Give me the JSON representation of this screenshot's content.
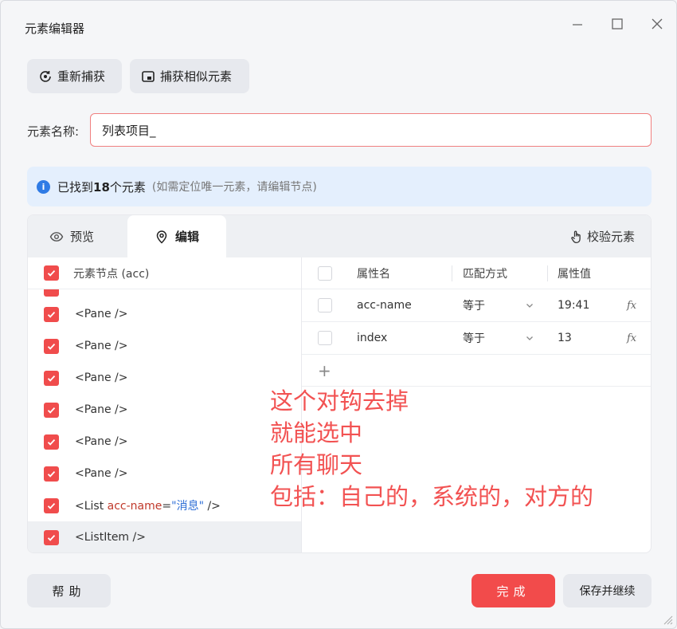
{
  "window": {
    "title": "元素编辑器"
  },
  "toolbar": {
    "recapture_label": "重新捕获",
    "capture_similar_label": "捕获相似元素"
  },
  "element_name": {
    "label": "元素名称:",
    "value": "列表项目_"
  },
  "info": {
    "found_prefix": "已找到",
    "count": "18",
    "found_suffix": "个元素",
    "hint": "(如需定位唯一元素，请编辑节点)"
  },
  "tabs": {
    "preview_label": "预览",
    "edit_label": "编辑",
    "verify_label": "校验元素",
    "active": "edit"
  },
  "tree": {
    "header_label": "元素节点 (acc)",
    "rows": [
      {
        "text": "<Pane />",
        "checked": true
      },
      {
        "text": "<Pane />",
        "checked": true
      },
      {
        "text": "<Pane />",
        "checked": true
      },
      {
        "text": "<Pane />",
        "checked": true
      },
      {
        "text": "<Pane />",
        "checked": true
      },
      {
        "text": "<Pane />",
        "checked": true
      }
    ],
    "list_row": {
      "open": "<List ",
      "attr_name": "acc-name",
      "eq": "=",
      "attr_value": "\"消息\"",
      "close": " />",
      "checked": true
    },
    "selected_row": {
      "text": "<ListItem />",
      "checked": true
    }
  },
  "attributes": {
    "headers": {
      "name": "属性名",
      "match": "匹配方式",
      "value": "属性值"
    },
    "rows": [
      {
        "name": "acc-name",
        "match": "等于",
        "value": "19:41",
        "fx": "fx",
        "checked": false
      },
      {
        "name": "index",
        "match": "等于",
        "value": "13",
        "fx": "fx",
        "checked": false
      }
    ],
    "add_label": "+"
  },
  "annotation": {
    "lines": [
      "这个对钩去掉",
      "就能选中",
      "所有聊天",
      "包括：自己的，系统的，对方的"
    ],
    "color": "#f25252"
  },
  "footer": {
    "help_label": "帮助",
    "done_label": "完成",
    "save_continue_label": "保存并继续"
  },
  "colors": {
    "accent": "#f24b4b",
    "info_bg": "#e4effd",
    "info_icon": "#2f7be5"
  }
}
